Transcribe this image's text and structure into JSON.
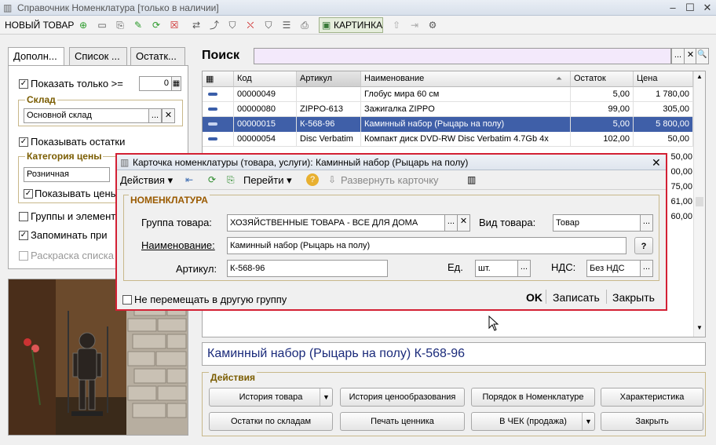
{
  "window": {
    "title": "Справочник Номенклатура [только в наличии]",
    "min": "‒",
    "max": "☐",
    "close": "✕"
  },
  "toolbar": {
    "new_item": "НОВЫЙ ТОВАР",
    "picture": "КАРТИНКА"
  },
  "tabs": [
    "Дополн...",
    "Список ...",
    "Остатк..."
  ],
  "filters": {
    "show_only": "Показать только  >=",
    "threshold": "0",
    "warehouse_title": "Склад",
    "warehouse_value": "Основной склад",
    "show_stock": "Показывать остатки",
    "price_cat_title": "Категория цены",
    "price_cat_value": "Розничная",
    "show_prices": "Показывать цены",
    "groups": "Группы и элементы",
    "remember": "Запоминать при",
    "color_list": "Раскраска списка"
  },
  "search": {
    "label": "Поиск",
    "value": "",
    "dots": "...",
    "clear": "✕",
    "go": "🔍"
  },
  "grid": {
    "headers": [
      "Код",
      "Артикул",
      "Наименование",
      "Остаток",
      "Цена"
    ],
    "rows": [
      [
        "00000049",
        "",
        "Глобус мира 60 см",
        "5,00",
        "1 780,00"
      ],
      [
        "00000080",
        "ZIPPO-613",
        "Зажигалка ZIPPO",
        "99,00",
        "305,00"
      ],
      [
        "00000015",
        "К-568-96",
        "Каминный набор (Рыцарь на полу)",
        "5,00",
        "5 800,00"
      ],
      [
        "00000054",
        "Disc Verbatim",
        "Компакт диск DVD-RW Disc Verbatim 4.7Gb 4x",
        "102,00",
        "50,00"
      ]
    ],
    "hidden_prices": [
      "50,00",
      "00,00",
      "75,00",
      "61,00",
      "60,00"
    ]
  },
  "selected_title": "Каминный набор (Рыцарь на полу) К-568-96",
  "actions": {
    "title": "Действия",
    "buttons": [
      "История товара",
      "История ценообразования",
      "Порядок в Номенклатуре",
      "Характеристика",
      "Остатки по складам",
      "Печать ценника",
      "В ЧЕК (продажа)",
      "Закрыть"
    ]
  },
  "dialog": {
    "title": "Карточка номенклатуры (товара, услуги): Каминный набор (Рыцарь на полу)",
    "close": "✕",
    "actions": "Действия",
    "goto": "Перейти",
    "expand": "Развернуть карточку",
    "group_title": "НОМЕНКЛАТУРА",
    "group_label": "Группа товара:",
    "group_value": "ХОЗЯЙСТВЕННЫЕ ТОВАРА - ВСЕ ДЛЯ ДОМА",
    "kind_label": "Вид товара:",
    "kind_value": "Товар",
    "name_label": "Наименование:",
    "name_value": "Каминный набор (Рыцарь на полу)",
    "help": "?",
    "article_label": "Артикул:",
    "article_value": "К-568-96",
    "unit_label": "Ед.",
    "unit_value": "шт.",
    "vat_label": "НДС:",
    "vat_value": "Без НДС",
    "no_move": "Не перемещать в другую группу",
    "ok": "OK",
    "save": "Записать",
    "close_btn": "Закрыть"
  }
}
